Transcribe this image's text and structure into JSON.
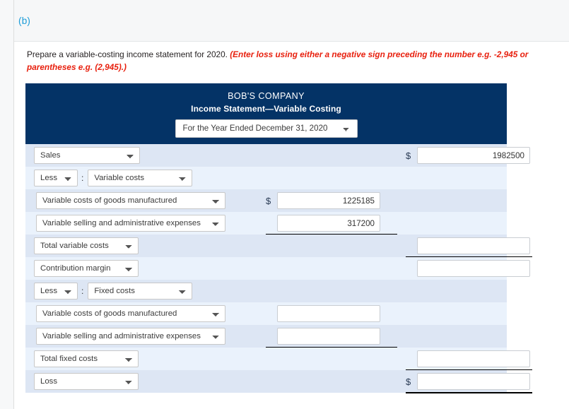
{
  "part": {
    "label": "(b)"
  },
  "instructions": {
    "main": "Prepare a variable-costing income statement for 2020. ",
    "requirement": "(Enter loss using either a negative sign preceding the number e.g. -2,945 or parentheses e.g. (2,945).)"
  },
  "statement": {
    "company": "BOB'S COMPANY",
    "subtitle": "Income Statement—Variable Costing",
    "period_selected": "For the Year Ended December 31, 2020",
    "rows": [
      {
        "id": "sales",
        "label": "Sales",
        "mid_dollar": "",
        "mid_value": "",
        "right_dollar": "$",
        "right_value": "1982500"
      },
      {
        "id": "less-variable-costs",
        "prefix": "Less",
        "colon": ":",
        "label": "Variable costs",
        "mid_dollar": "",
        "mid_value": "",
        "right_dollar": "",
        "right_value": ""
      },
      {
        "id": "variable-cogm",
        "label": "Variable costs of goods manufactured",
        "mid_dollar": "$",
        "mid_value": "1225185",
        "right_dollar": "",
        "right_value": ""
      },
      {
        "id": "variable-sga",
        "label": "Variable selling and administrative expenses",
        "mid_dollar": "",
        "mid_value": "317200",
        "right_dollar": "",
        "right_value": ""
      },
      {
        "id": "total-variable-costs",
        "label": "Total variable costs",
        "mid_dollar": "",
        "mid_value": "",
        "right_dollar": "",
        "right_value": ""
      },
      {
        "id": "contribution-margin",
        "label": "Contribution margin",
        "mid_dollar": "",
        "mid_value": "",
        "right_dollar": "",
        "right_value": ""
      },
      {
        "id": "less-fixed-costs",
        "prefix": "Less",
        "colon": ":",
        "label": "Fixed costs",
        "mid_dollar": "",
        "mid_value": "",
        "right_dollar": "",
        "right_value": ""
      },
      {
        "id": "fixed-cogm",
        "label": "Variable costs of goods manufactured",
        "mid_dollar": "",
        "mid_value": "",
        "right_dollar": "",
        "right_value": ""
      },
      {
        "id": "fixed-sga",
        "label": "Variable selling and administrative expenses",
        "mid_dollar": "",
        "mid_value": "",
        "right_dollar": "",
        "right_value": ""
      },
      {
        "id": "total-fixed-costs",
        "label": "Total fixed costs",
        "mid_dollar": "",
        "mid_value": "",
        "right_dollar": "",
        "right_value": ""
      },
      {
        "id": "loss",
        "label": "Loss",
        "mid_dollar": "",
        "mid_value": "",
        "right_dollar": "$",
        "right_value": ""
      }
    ]
  },
  "colors": {
    "header_blue": "#043366",
    "row_odd": "#dde6f4",
    "row_even": "#eaf2fc",
    "part_label_blue": "#1a9bd8",
    "requirement_red": "#e8200e"
  }
}
